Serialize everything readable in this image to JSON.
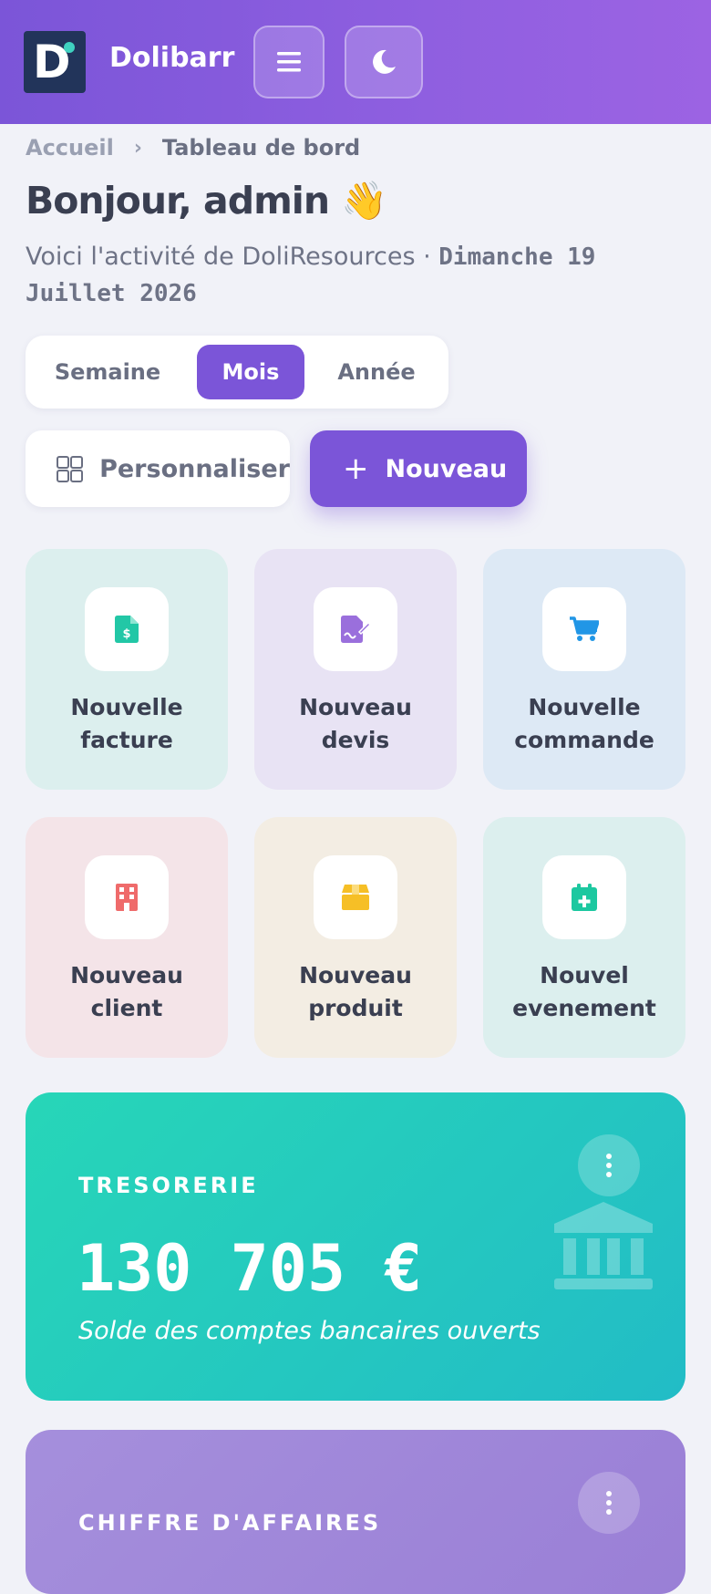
{
  "header": {
    "app_name": "Dolibarr",
    "logo_letter": "D",
    "icons": {
      "menu": "hamburger-icon",
      "theme": "moon-icon"
    }
  },
  "breadcrumb": {
    "home": "Accueil",
    "separator": "›",
    "current": "Tableau de bord"
  },
  "greeting": "Bonjour, admin 👋",
  "subtitle": {
    "text": "Voici l'activité de DoliResources · ",
    "date": "Dimanche 19 Juillet 2026"
  },
  "period_selector": {
    "options": [
      "Semaine",
      "Mois",
      "Année"
    ],
    "selected": "Mois"
  },
  "actions": {
    "customize": "Personnaliser",
    "new": "Nouveau"
  },
  "quick_actions": [
    {
      "line1": "Nouvelle",
      "line2": "facture",
      "icon": "invoice-dollar-icon",
      "color": "#22c7a6",
      "bg": "#dcefee"
    },
    {
      "line1": "Nouveau",
      "line2": "devis",
      "icon": "signed-document-icon",
      "color": "#9a6fdc",
      "bg": "#e8e3f4"
    },
    {
      "line1": "Nouvelle",
      "line2": "commande",
      "icon": "shopping-cart-icon",
      "color": "#2196e6",
      "bg": "#dde9f5"
    },
    {
      "line1": "Nouveau",
      "line2": "client",
      "icon": "building-icon",
      "color": "#ef6b6b",
      "bg": "#f4e4e8"
    },
    {
      "line1": "Nouveau",
      "line2": "produit",
      "icon": "box-icon",
      "color": "#f6bf26",
      "bg": "#f3ede3"
    },
    {
      "line1": "Nouvel",
      "line2": "evenement",
      "icon": "calendar-plus-icon",
      "color": "#1cc8a0",
      "bg": "#dcefee"
    }
  ],
  "cards": {
    "treasury": {
      "title": "TRESORERIE",
      "value": "130 705 €",
      "description": "Solde des comptes bancaires ouverts",
      "icon": "bank-icon"
    },
    "revenue": {
      "title": "CHIFFRE D'AFFAIRES"
    }
  }
}
